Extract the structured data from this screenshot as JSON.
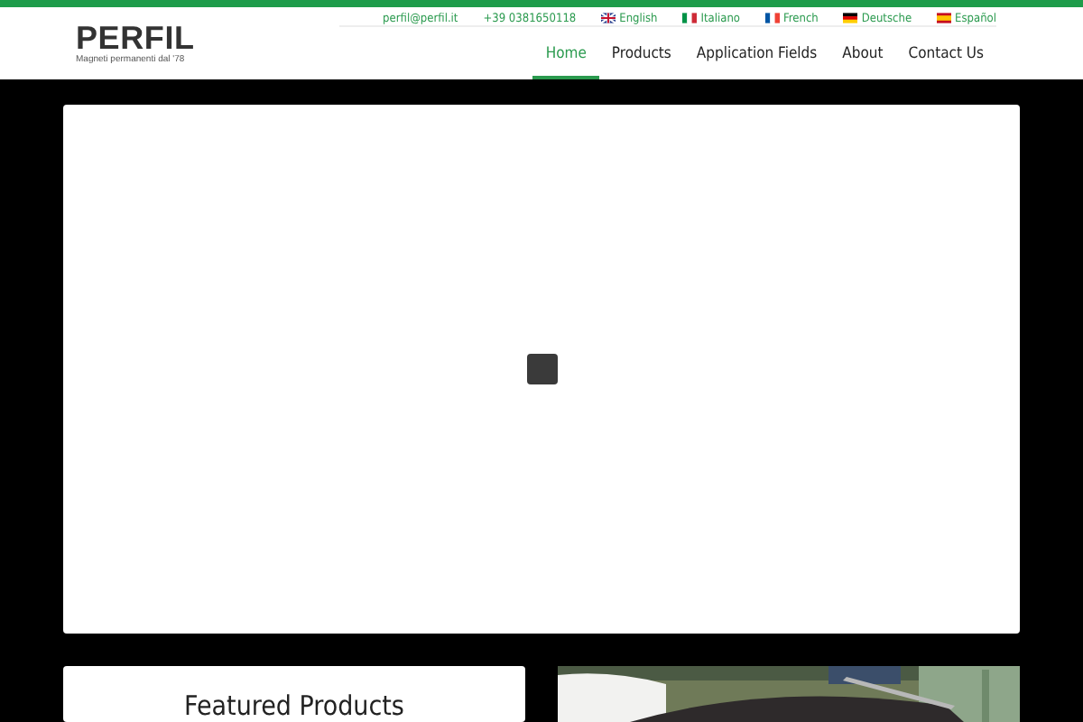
{
  "logo": {
    "name": "PERFIL",
    "tagline": "Magneti permanenti dal '78"
  },
  "top_links": [
    {
      "kind": "text",
      "label": "perfil@perfil.it"
    },
    {
      "kind": "text",
      "label": "+39 0381650118"
    },
    {
      "kind": "uk",
      "label": "English"
    },
    {
      "kind": "it",
      "label": "Italiano"
    },
    {
      "kind": "fr",
      "label": "French"
    },
    {
      "kind": "de",
      "label": "Deutsche"
    },
    {
      "kind": "es",
      "label": "Español"
    }
  ],
  "nav": [
    {
      "label": "Home",
      "selected": true
    },
    {
      "label": "Products",
      "selected": false
    },
    {
      "label": "Application Fields",
      "selected": false
    },
    {
      "label": "About",
      "selected": false
    },
    {
      "label": "Contact Us",
      "selected": false
    }
  ],
  "slider": {
    "loading": true
  },
  "featured": {
    "title": "Featured Products"
  }
}
